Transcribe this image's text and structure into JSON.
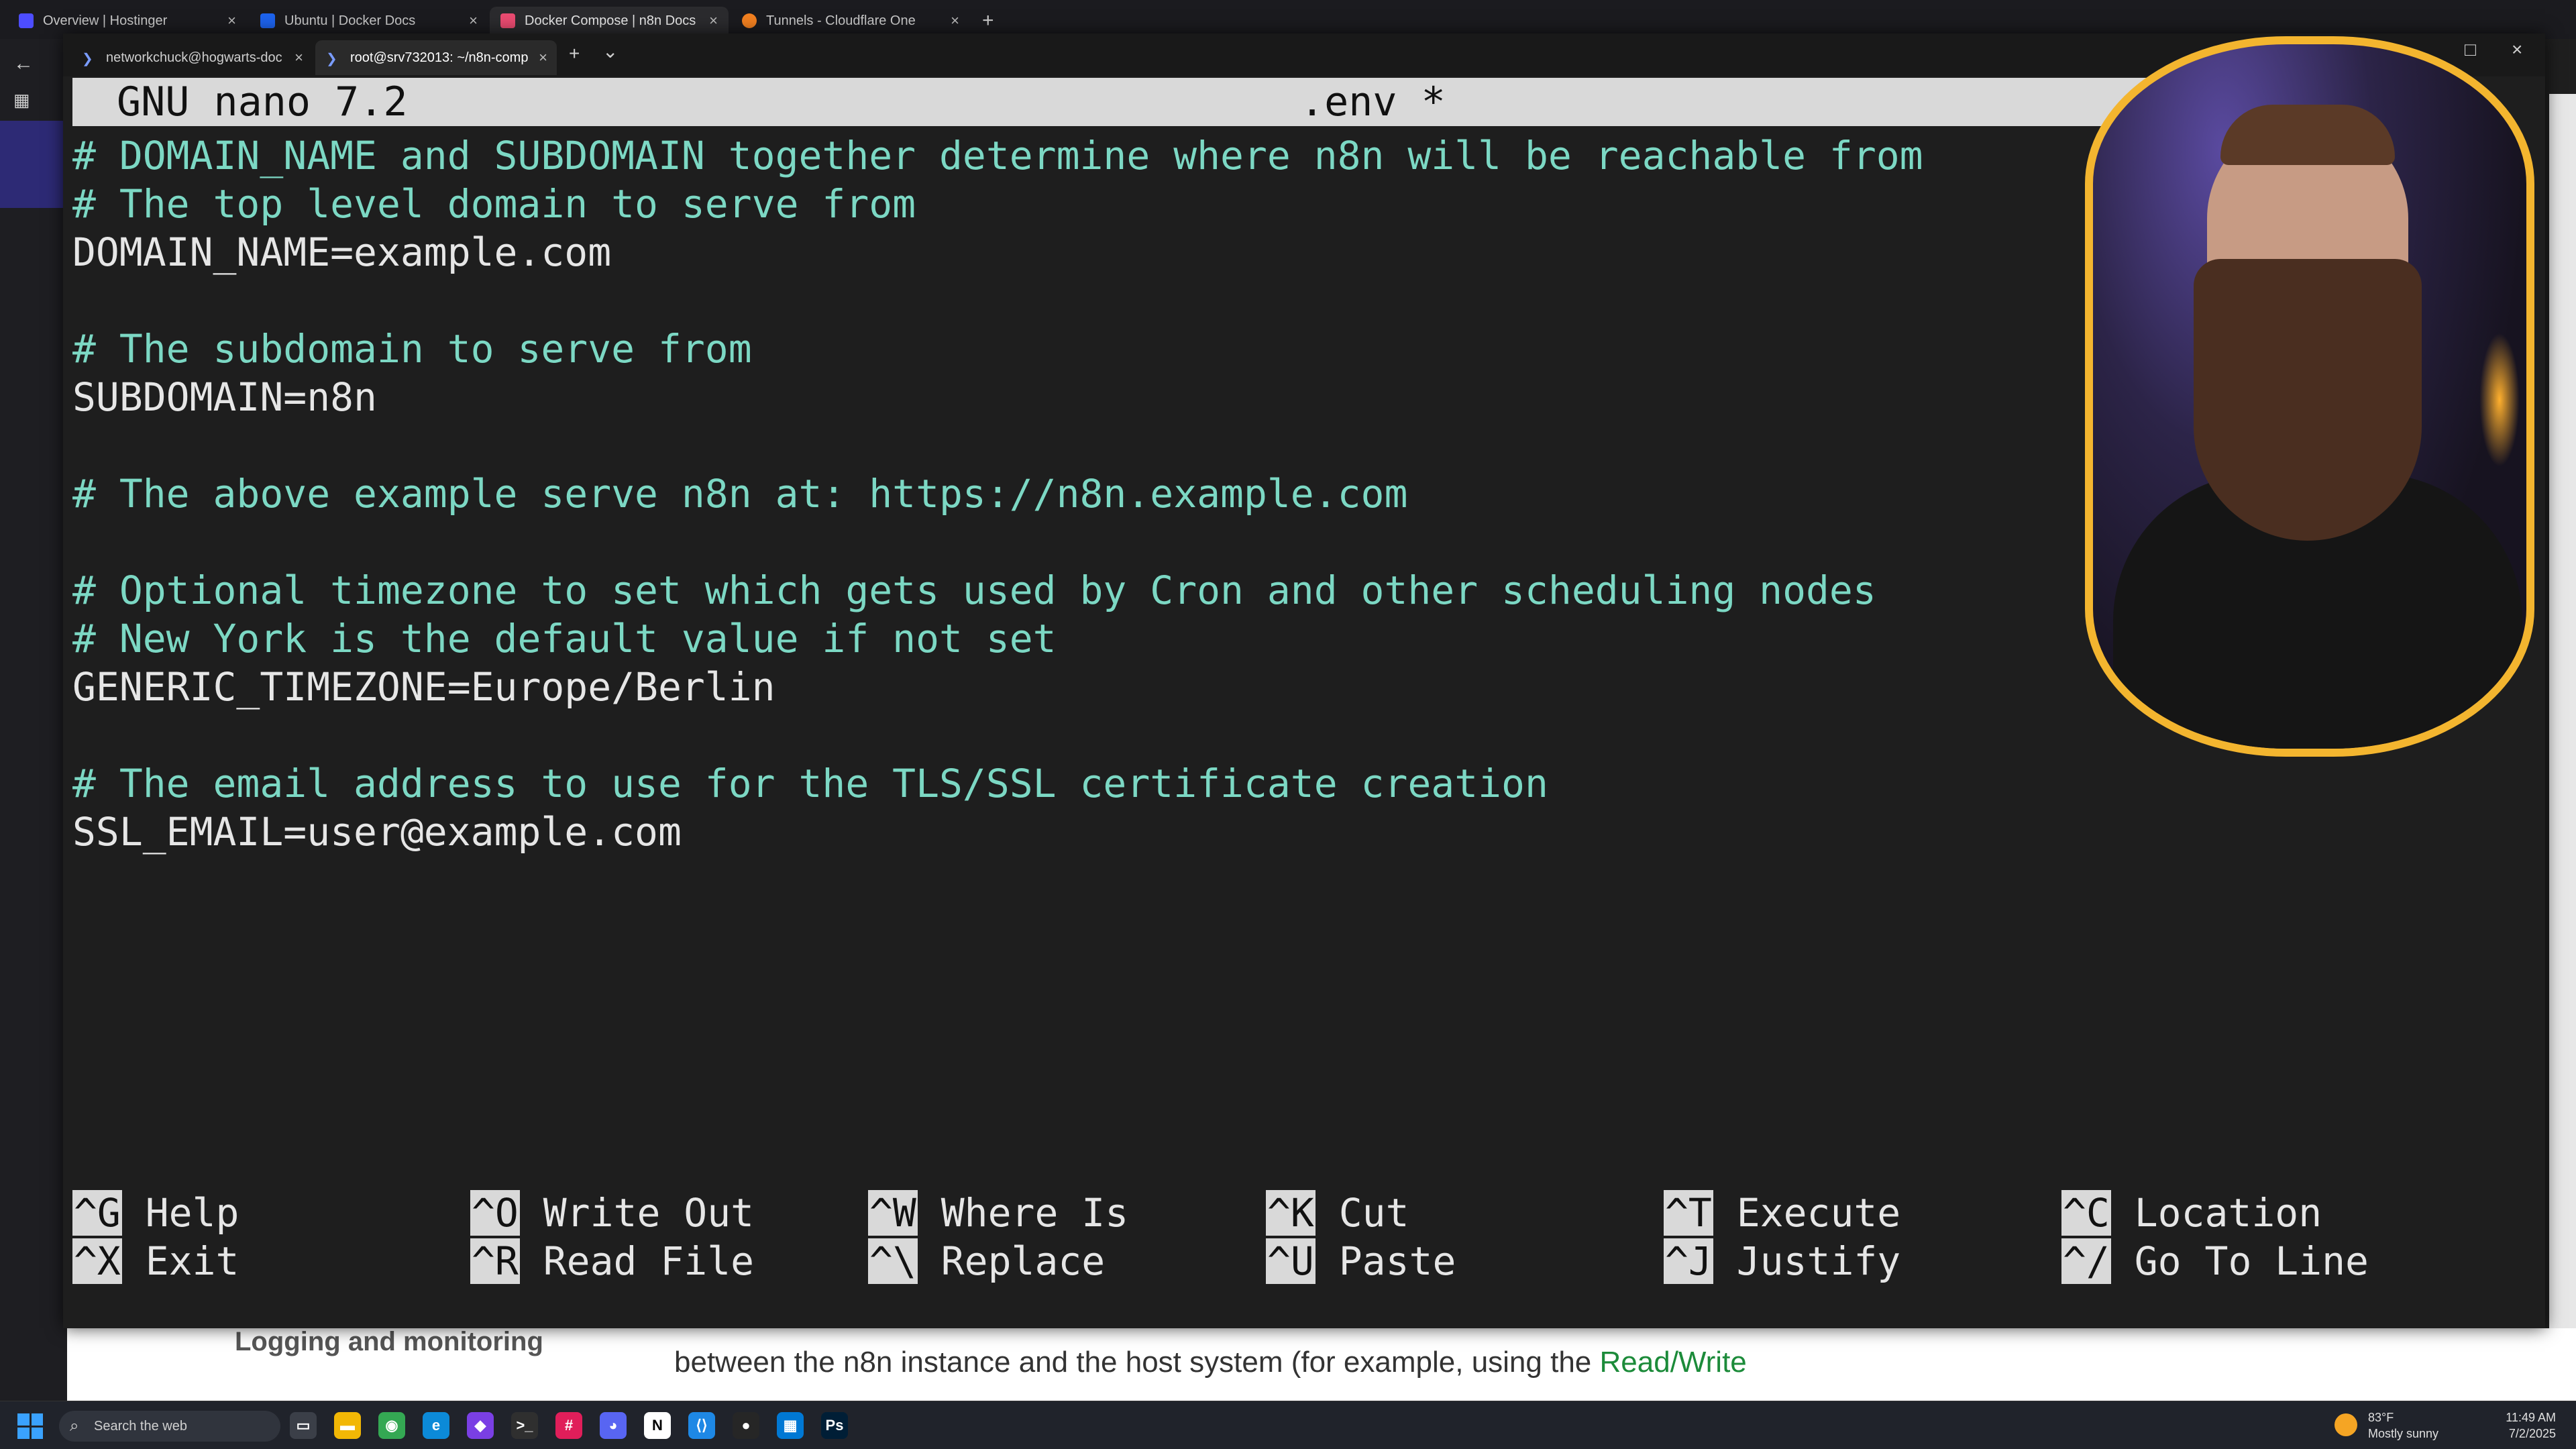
{
  "browser": {
    "tabs": [
      {
        "label": "Overview | Hostinger",
        "color": "#4d4dff"
      },
      {
        "label": "Ubuntu | Docker Docs",
        "color": "#1d63ed"
      },
      {
        "label": "Docker Compose | n8n Docs",
        "color": "#ea4b71",
        "active": true
      },
      {
        "label": "Tunnels - Cloudflare One",
        "color": "#f38020"
      }
    ],
    "new_tab": "+"
  },
  "website": {
    "sidebar_item": "Logging and monitoring",
    "sentence_prefix": "between the n8n instance and the host system (for example, using the ",
    "sentence_link": "Read/Write"
  },
  "terminal": {
    "tabs": [
      {
        "label": "networkchuck@hogwarts-doc"
      },
      {
        "label": "root@srv732013: ~/n8n-comp",
        "active": true
      }
    ],
    "new_tab": "+",
    "dropdown": "⌄"
  },
  "nano": {
    "version": "GNU nano 7.2",
    "filename": ".env *",
    "lines": [
      {
        "text": "# DOMAIN_NAME and SUBDOMAIN together determine where n8n will be reachable from",
        "type": "comment"
      },
      {
        "text": "# The top level domain to serve from",
        "type": "comment"
      },
      {
        "text": "DOMAIN_NAME=example.com",
        "type": "plain"
      },
      {
        "text": "",
        "type": "plain"
      },
      {
        "text": "# The subdomain to serve from",
        "type": "comment"
      },
      {
        "text": "SUBDOMAIN=n8n",
        "type": "plain"
      },
      {
        "text": "",
        "type": "plain"
      },
      {
        "text": "# The above example serve n8n at: https://n8n.example.com",
        "type": "comment"
      },
      {
        "text": "",
        "type": "plain"
      },
      {
        "text": "# Optional timezone to set which gets used by Cron and other scheduling nodes",
        "type": "comment"
      },
      {
        "text": "# New York is the default value if not set",
        "type": "comment"
      },
      {
        "text": "GENERIC_TIMEZONE=Europe/Berlin",
        "type": "plain"
      },
      {
        "text": "",
        "type": "plain"
      },
      {
        "text": "# The email address to use for the TLS/SSL certificate creation",
        "type": "comment"
      },
      {
        "text": "SSL_EMAIL=user@example.com",
        "type": "plain"
      }
    ],
    "shortcuts": [
      {
        "key": "^G",
        "label": "Help"
      },
      {
        "key": "^X",
        "label": "Exit"
      },
      {
        "key": "^O",
        "label": "Write Out"
      },
      {
        "key": "^R",
        "label": "Read File"
      },
      {
        "key": "^W",
        "label": "Where Is"
      },
      {
        "key": "^\\",
        "label": "Replace"
      },
      {
        "key": "^K",
        "label": "Cut"
      },
      {
        "key": "^U",
        "label": "Paste"
      },
      {
        "key": "^T",
        "label": "Execute"
      },
      {
        "key": "^J",
        "label": "Justify"
      },
      {
        "key": "^C",
        "label": "Location"
      },
      {
        "key": "^/",
        "label": "Go To Line"
      }
    ]
  },
  "taskbar": {
    "search_placeholder": "Search the web",
    "weather_temp": "83°F",
    "weather_desc": "Mostly sunny",
    "time": "11:49 AM",
    "date": "7/2/2025",
    "apps": [
      {
        "name": "task-view",
        "color": "#3b3f48",
        "glyph": "▭"
      },
      {
        "name": "file-explorer",
        "color": "#f2b705",
        "glyph": "▬"
      },
      {
        "name": "chrome",
        "color": "#34a853",
        "glyph": "◉"
      },
      {
        "name": "edge",
        "color": "#0c8ad8",
        "glyph": "e"
      },
      {
        "name": "obsidian",
        "color": "#7a3fe4",
        "glyph": "◆"
      },
      {
        "name": "terminal",
        "color": "#2f2f2f",
        "glyph": ">_"
      },
      {
        "name": "slack",
        "color": "#e01e5a",
        "glyph": "#"
      },
      {
        "name": "discord",
        "color": "#5865f2",
        "glyph": "◕"
      },
      {
        "name": "notion",
        "color": "#ffffff",
        "glyph": "N"
      },
      {
        "name": "vscode",
        "color": "#1e88e5",
        "glyph": "⟨⟩"
      },
      {
        "name": "obs",
        "color": "#262626",
        "glyph": "●"
      },
      {
        "name": "app-grid",
        "color": "#0078d4",
        "glyph": "▦"
      },
      {
        "name": "photoshop",
        "color": "#001e36",
        "glyph": "Ps"
      }
    ]
  }
}
